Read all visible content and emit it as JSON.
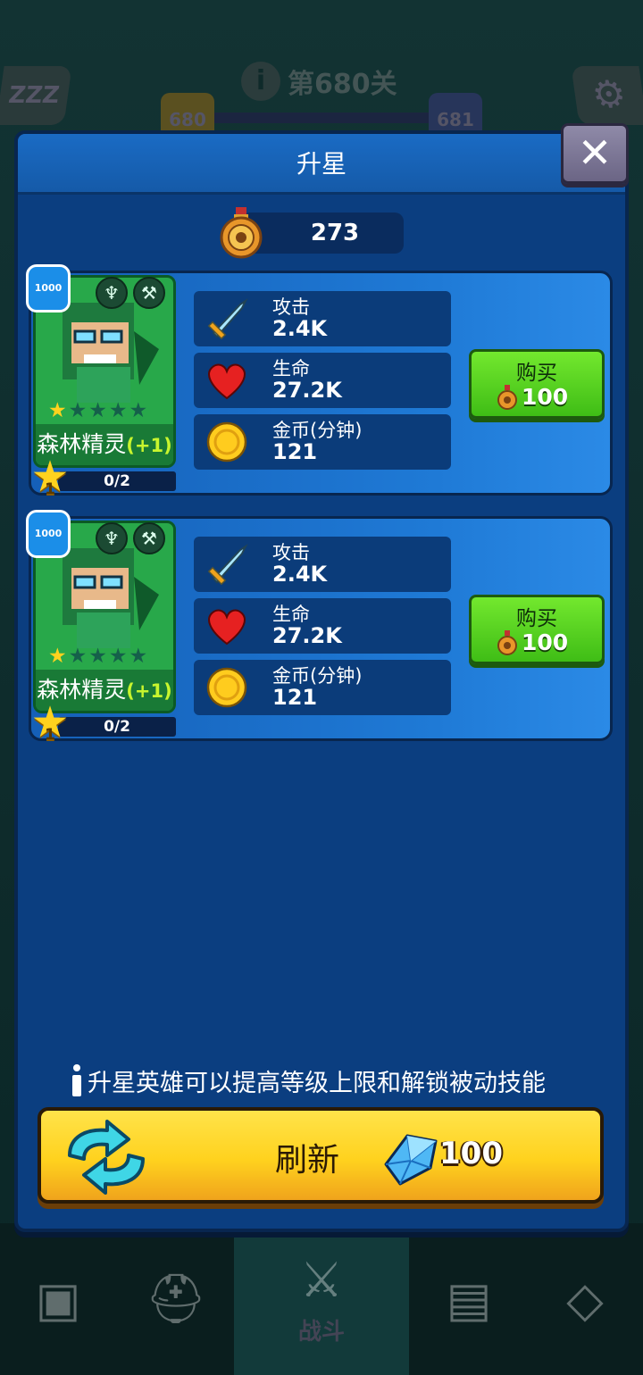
{
  "background": {
    "level_title": "第680关",
    "current_level": "680",
    "next_level": "681",
    "sleep_label": "ZZZ",
    "nav": {
      "battle_label": "战斗"
    }
  },
  "modal": {
    "title": "升星",
    "close_label": "✕",
    "medal_count": "273"
  },
  "heroes": [
    {
      "power_badge": "1000",
      "name": "森林精灵",
      "name_bonus": "(+1)",
      "stars_filled": 1,
      "stars_total": 5,
      "star_level": "1",
      "progress": "0/2",
      "stats": {
        "attack_label": "攻击",
        "attack_value": "2.4K",
        "hp_label": "生命",
        "hp_value": "27.2K",
        "gold_label": "金币(分钟)",
        "gold_value": "121"
      },
      "buy_label": "购买",
      "buy_price": "100"
    },
    {
      "power_badge": "1000",
      "name": "森林精灵",
      "name_bonus": "(+1)",
      "stars_filled": 1,
      "stars_total": 5,
      "star_level": "1",
      "progress": "0/2",
      "stats": {
        "attack_label": "攻击",
        "attack_value": "2.4K",
        "hp_label": "生命",
        "hp_value": "27.2K",
        "gold_label": "金币(分钟)",
        "gold_value": "121"
      },
      "buy_label": "购买",
      "buy_price": "100"
    }
  ],
  "footer": {
    "hint": "升星英雄可以提高等级上限和解锁被动技能",
    "refresh_label": "刷新",
    "refresh_price": "100"
  },
  "colors": {
    "modal_bg": "#0b3e80",
    "buy_green": "#4fcf1c",
    "refresh_yellow": "#ffd21e"
  }
}
